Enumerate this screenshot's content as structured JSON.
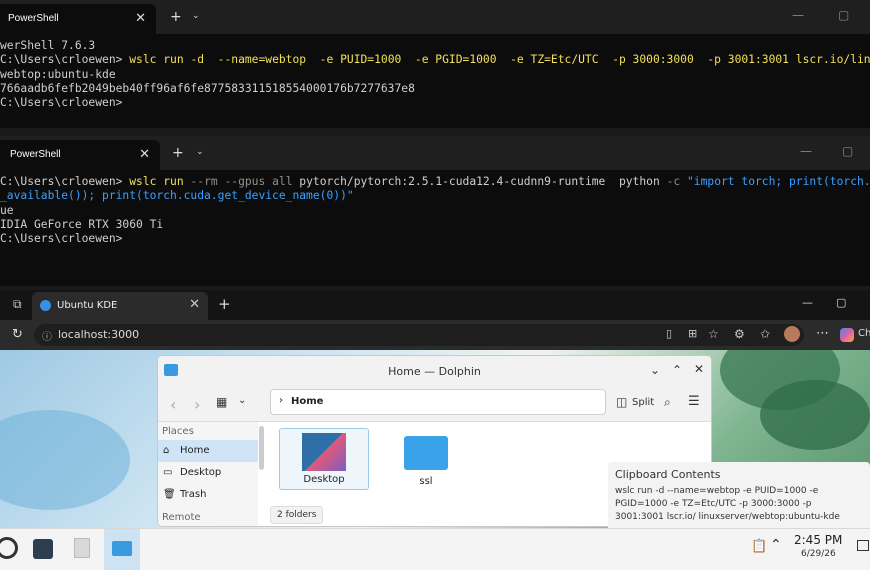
{
  "term1": {
    "tab_title": "PowerShell",
    "lines": [
      "werShell 7.6.3",
      "C:\\Users\\crloewen>",
      "webtop:ubuntu-kde",
      "766aadb6fefb2049beb40ff96af6fe877583311518554000176b7277637e8",
      "C:\\Users\\crloewen>"
    ],
    "cmd": "wslc run -d  --name=webtop  -e PUID=1000  -e PGID=1000  -e TZ=Etc/UTC  -p 3000:3000  -p 3001:3001 lscr.io/linuxse"
  },
  "term2": {
    "tab_title": "PowerShell",
    "prompt": "C:\\Users\\crloewen>",
    "cmd_a": "wslc run",
    "cmd_b": " --rm --gpus all ",
    "cmd_c": "pytorch/pytorch:2.5.1-cuda12.4-cudnn9-runtime  python ",
    "cmd_d": "-c ",
    "cmd_e": "\"import torch; print(torch.cuda",
    "cont": "_available()); print(torch.cuda.get_device_name(0))\"",
    "out1": "ue",
    "out2": "IDIA GeForce RTX 3060 Ti",
    "prompt2": "C:\\Users\\crloewen>"
  },
  "browser": {
    "tab_title": "Ubuntu KDE",
    "url": "localhost:3000",
    "copilot": "Ch"
  },
  "dolphin": {
    "title": "Home — Dolphin",
    "split": "Split",
    "crumb": "Home",
    "places_header": "Places",
    "places": [
      "Home",
      "Desktop",
      "Trash"
    ],
    "remote": "Remote",
    "files": [
      "Desktop",
      "ssl"
    ],
    "status": "2 folders"
  },
  "clipboard": {
    "title": "Clipboard Contents",
    "text": "wslc run -d  --name=webtop  -e PUID=1000  -e PGID=1000  -e TZ=Etc/UTC  -p 3000:3000  -p 3001:3001 lscr.io/ linuxserver/webtop:ubuntu-kde"
  },
  "taskbar": {
    "time": "2:45 PM",
    "date": "6/29/26"
  }
}
